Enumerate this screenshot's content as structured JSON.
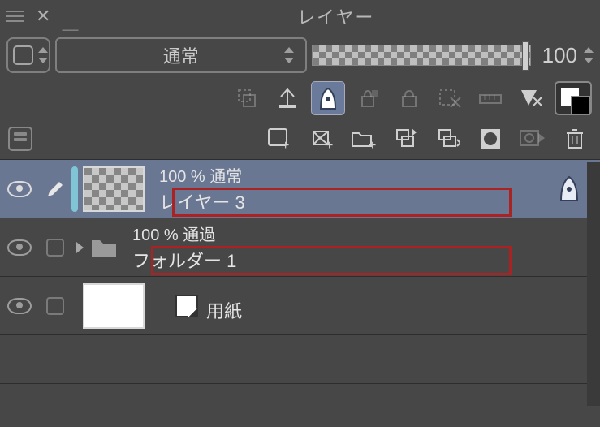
{
  "title": "レイヤー",
  "blend_mode": "通常",
  "opacity_value": "100",
  "layers": [
    {
      "opacity": "100 %",
      "mode": "通常",
      "name": "レイヤー 3",
      "selected": true
    },
    {
      "opacity": "100 %",
      "mode": "通過",
      "name": "フォルダー 1",
      "type": "folder"
    },
    {
      "name": "用紙",
      "type": "paper"
    }
  ]
}
